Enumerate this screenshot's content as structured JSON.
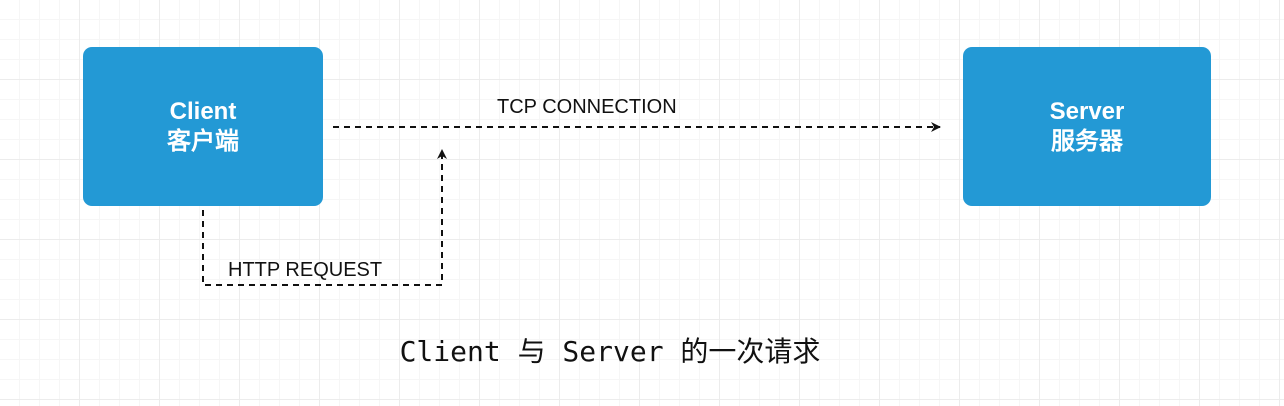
{
  "nodes": {
    "client": {
      "title": "Client",
      "subtitle": "客户端"
    },
    "server": {
      "title": "Server",
      "subtitle": "服务器"
    }
  },
  "edges": {
    "tcp": {
      "label": "TCP CONNECTION"
    },
    "http": {
      "label": "HTTP REQUEST"
    }
  },
  "caption": "Client 与 Server 的一次请求",
  "colors": {
    "node_fill": "#2399d5",
    "node_text": "#ffffff",
    "edge": "#111111"
  }
}
